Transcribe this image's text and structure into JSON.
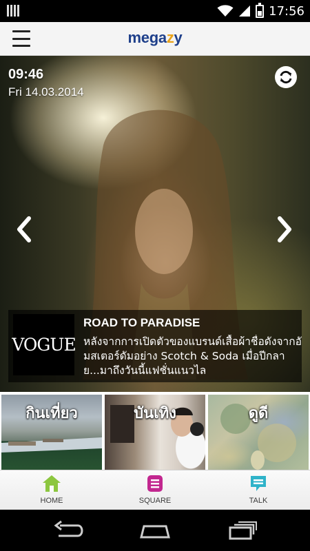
{
  "status_bar": {
    "time": "17:56"
  },
  "header": {
    "logo_prefix": "mega",
    "logo_mark": "z",
    "logo_suffix": "y",
    "menu_icon": "hamburger-menu-icon"
  },
  "hero": {
    "time": "09:46",
    "date": "Fri 14.03.2014",
    "refresh_icon": "refresh-icon",
    "prev_icon": "chevron-left-icon",
    "next_icon": "chevron-right-icon",
    "article": {
      "thumb_text": "VOGUE",
      "title": "ROAD TO PARADISE",
      "body": "หลังจากการเปิดตัวของแบรนด์เสื้อผ้าชื่อดังจากอัมสเตอร์ดัมอย่าง Scotch & Soda เมื่อปีกลาย...มาถึงวันนี้แฟชั่นแนวไล"
    }
  },
  "tiles": [
    {
      "label": "กินเที่ยว"
    },
    {
      "label": "บันเทิง"
    },
    {
      "label": "ดูดี"
    }
  ],
  "tabs": [
    {
      "label": "HOME",
      "icon": "home-icon",
      "color": "#8cc63f"
    },
    {
      "label": "SQUARE",
      "icon": "square-icon",
      "color": "#c2278f"
    },
    {
      "label": "TALK",
      "icon": "talk-bubble-icon",
      "color": "#2fb3c9"
    }
  ],
  "system_nav": {
    "back_icon": "back-icon",
    "home_icon": "home-outline-icon",
    "recents_icon": "recents-icon"
  }
}
